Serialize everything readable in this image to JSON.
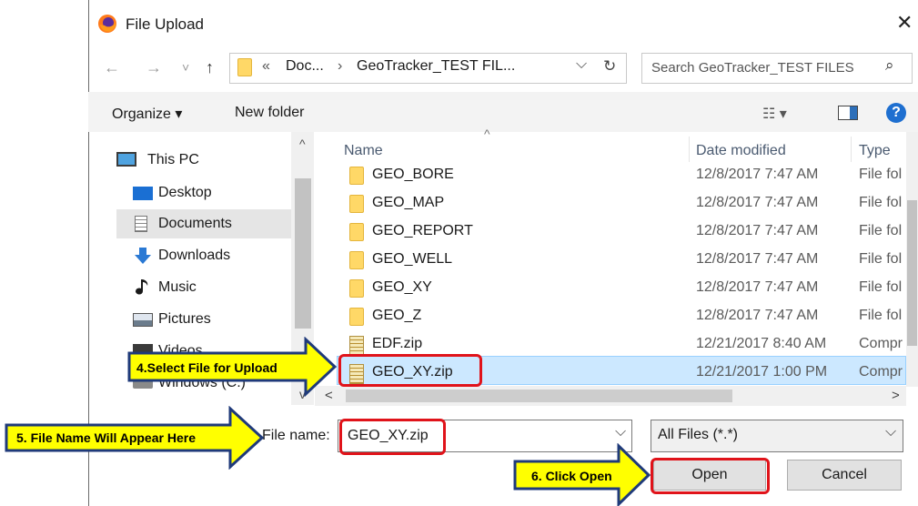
{
  "window": {
    "title": "File Upload",
    "close_glyph": "✕"
  },
  "nav": {
    "back_glyph": "←",
    "forward_glyph": "→",
    "recent_glyph": "˅",
    "up_glyph": "↑",
    "path_overflow": "«",
    "path_parts": [
      "Doc...",
      "GeoTracker_TEST FIL..."
    ],
    "path_sep": "›",
    "dropdown_glyph": "⌵",
    "refresh_glyph": "↻",
    "search_placeholder": "Search GeoTracker_TEST FILES",
    "search_glyph": "⌕"
  },
  "toolbar": {
    "organize_label": "Organize ▾",
    "new_folder_label": "New folder",
    "view_glyph": "☷ ▾",
    "help_label": "?"
  },
  "sidebar": {
    "items": [
      {
        "label": "This PC",
        "icon": "monitor-icon"
      },
      {
        "label": "Desktop",
        "icon": "desktop-icon"
      },
      {
        "label": "Documents",
        "icon": "document-icon"
      },
      {
        "label": "Downloads",
        "icon": "download-arrow-icon"
      },
      {
        "label": "Music",
        "icon": "music-note-icon"
      },
      {
        "label": "Pictures",
        "icon": "picture-icon"
      },
      {
        "label": "Videos",
        "icon": "video-icon"
      },
      {
        "label": "Windows (C:)",
        "icon": "drive-icon"
      }
    ],
    "scroll_up": "^",
    "scroll_down": "v"
  },
  "file_list": {
    "columns": [
      "Name",
      "Date modified",
      "Type"
    ],
    "rows": [
      {
        "name": "GEO_BORE",
        "date": "12/8/2017 7:47 AM",
        "type": "File fol",
        "kind": "folder"
      },
      {
        "name": "GEO_MAP",
        "date": "12/8/2017 7:47 AM",
        "type": "File fol",
        "kind": "folder"
      },
      {
        "name": "GEO_REPORT",
        "date": "12/8/2017 7:47 AM",
        "type": "File fol",
        "kind": "folder"
      },
      {
        "name": "GEO_WELL",
        "date": "12/8/2017 7:47 AM",
        "type": "File fol",
        "kind": "folder"
      },
      {
        "name": "GEO_XY",
        "date": "12/8/2017 7:47 AM",
        "type": "File fol",
        "kind": "folder"
      },
      {
        "name": "GEO_Z",
        "date": "12/8/2017 7:47 AM",
        "type": "File fol",
        "kind": "folder"
      },
      {
        "name": "EDF.zip",
        "date": "12/21/2017 8:40 AM",
        "type": "Compr",
        "kind": "zip"
      },
      {
        "name": "GEO_XY.zip",
        "date": "12/21/2017 1:00 PM",
        "type": "Compr",
        "kind": "zip"
      }
    ],
    "hscroll_left": "<",
    "hscroll_right": ">"
  },
  "footer": {
    "file_name_label": "File name:",
    "file_name_value": "GEO_XY.zip",
    "filter_value": "All Files (*.*)",
    "combo_glyph": "⌵",
    "open_label": "Open",
    "cancel_label": "Cancel"
  },
  "annotations": {
    "step4": "4.Select File for Upload",
    "step5": "5. File Name Will Appear Here",
    "step6": "6. Click Open",
    "highlight_color": "#e0131a",
    "callout_color": "#ffff00",
    "arrow_color": "#1f3a7a"
  }
}
